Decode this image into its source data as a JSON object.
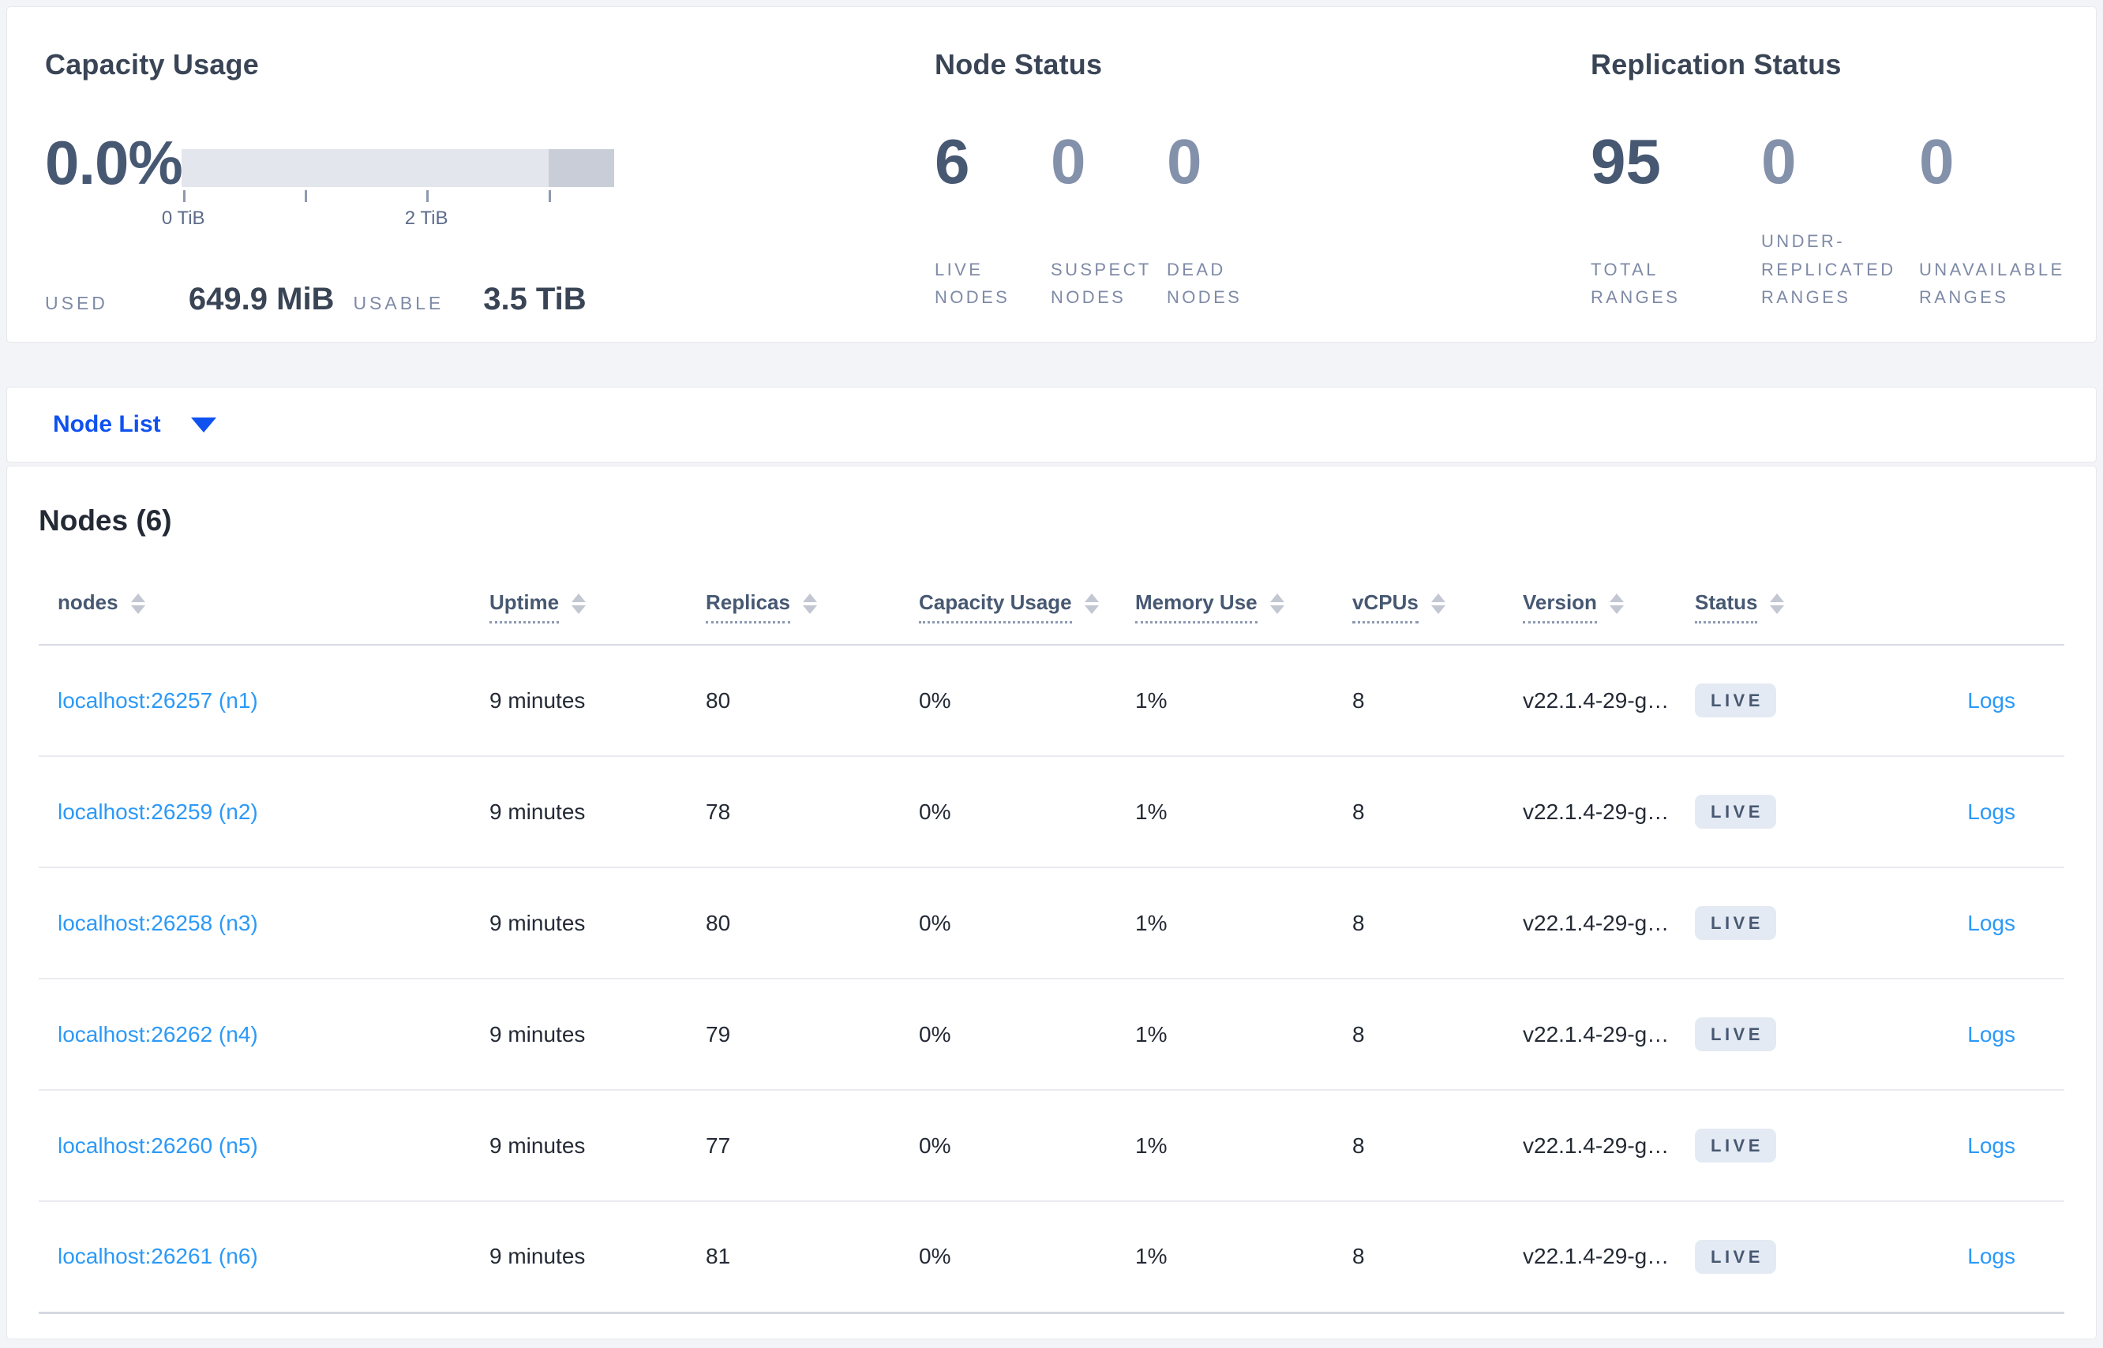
{
  "summary": {
    "capacity": {
      "title": "Capacity Usage",
      "percent": "0.0%",
      "tick_labels": {
        "t0": "0 TiB",
        "t2": "2 TiB"
      },
      "used_label": "USED",
      "used_value": "649.9 MiB",
      "usable_label": "USABLE",
      "usable_value": "3.5 TiB"
    },
    "node_status": {
      "title": "Node Status",
      "stats": [
        {
          "value": "6",
          "label": "LIVE NODES"
        },
        {
          "value": "0",
          "label": "SUSPECT NODES"
        },
        {
          "value": "0",
          "label": "DEAD NODES"
        }
      ]
    },
    "replication": {
      "title": "Replication Status",
      "stats": [
        {
          "value": "95",
          "label": "TOTAL RANGES"
        },
        {
          "value": "0",
          "label": "UNDER-REPLICATED RANGES"
        },
        {
          "value": "0",
          "label": "UNAVAILABLE RANGES"
        }
      ]
    }
  },
  "view_selector": {
    "label": "Node List"
  },
  "nodes": {
    "title": "Nodes (6)",
    "columns": [
      {
        "label": "nodes"
      },
      {
        "label": "Uptime"
      },
      {
        "label": "Replicas"
      },
      {
        "label": "Capacity Usage"
      },
      {
        "label": "Memory Use"
      },
      {
        "label": "vCPUs"
      },
      {
        "label": "Version"
      },
      {
        "label": "Status"
      }
    ],
    "rows": [
      {
        "node": "localhost:26257 (n1)",
        "uptime": "9 minutes",
        "replicas": "80",
        "capacity": "0%",
        "memory": "1%",
        "vcpus": "8",
        "version": "v22.1.4-29-g…",
        "status": "LIVE",
        "logs": "Logs"
      },
      {
        "node": "localhost:26259 (n2)",
        "uptime": "9 minutes",
        "replicas": "78",
        "capacity": "0%",
        "memory": "1%",
        "vcpus": "8",
        "version": "v22.1.4-29-g…",
        "status": "LIVE",
        "logs": "Logs"
      },
      {
        "node": "localhost:26258 (n3)",
        "uptime": "9 minutes",
        "replicas": "80",
        "capacity": "0%",
        "memory": "1%",
        "vcpus": "8",
        "version": "v22.1.4-29-g…",
        "status": "LIVE",
        "logs": "Logs"
      },
      {
        "node": "localhost:26262 (n4)",
        "uptime": "9 minutes",
        "replicas": "79",
        "capacity": "0%",
        "memory": "1%",
        "vcpus": "8",
        "version": "v22.1.4-29-g…",
        "status": "LIVE",
        "logs": "Logs"
      },
      {
        "node": "localhost:26260 (n5)",
        "uptime": "9 minutes",
        "replicas": "77",
        "capacity": "0%",
        "memory": "1%",
        "vcpus": "8",
        "version": "v22.1.4-29-g…",
        "status": "LIVE",
        "logs": "Logs"
      },
      {
        "node": "localhost:26261 (n6)",
        "uptime": "9 minutes",
        "replicas": "81",
        "capacity": "0%",
        "memory": "1%",
        "vcpus": "8",
        "version": "v22.1.4-29-g…",
        "status": "LIVE",
        "logs": "Logs"
      }
    ]
  },
  "colors": {
    "accent_blue": "#0f52f0",
    "link_blue": "#2b99f7",
    "dark_slate": "#475872",
    "muted_slate": "#7e8aa6",
    "badge_bg": "#e4eaf3"
  }
}
